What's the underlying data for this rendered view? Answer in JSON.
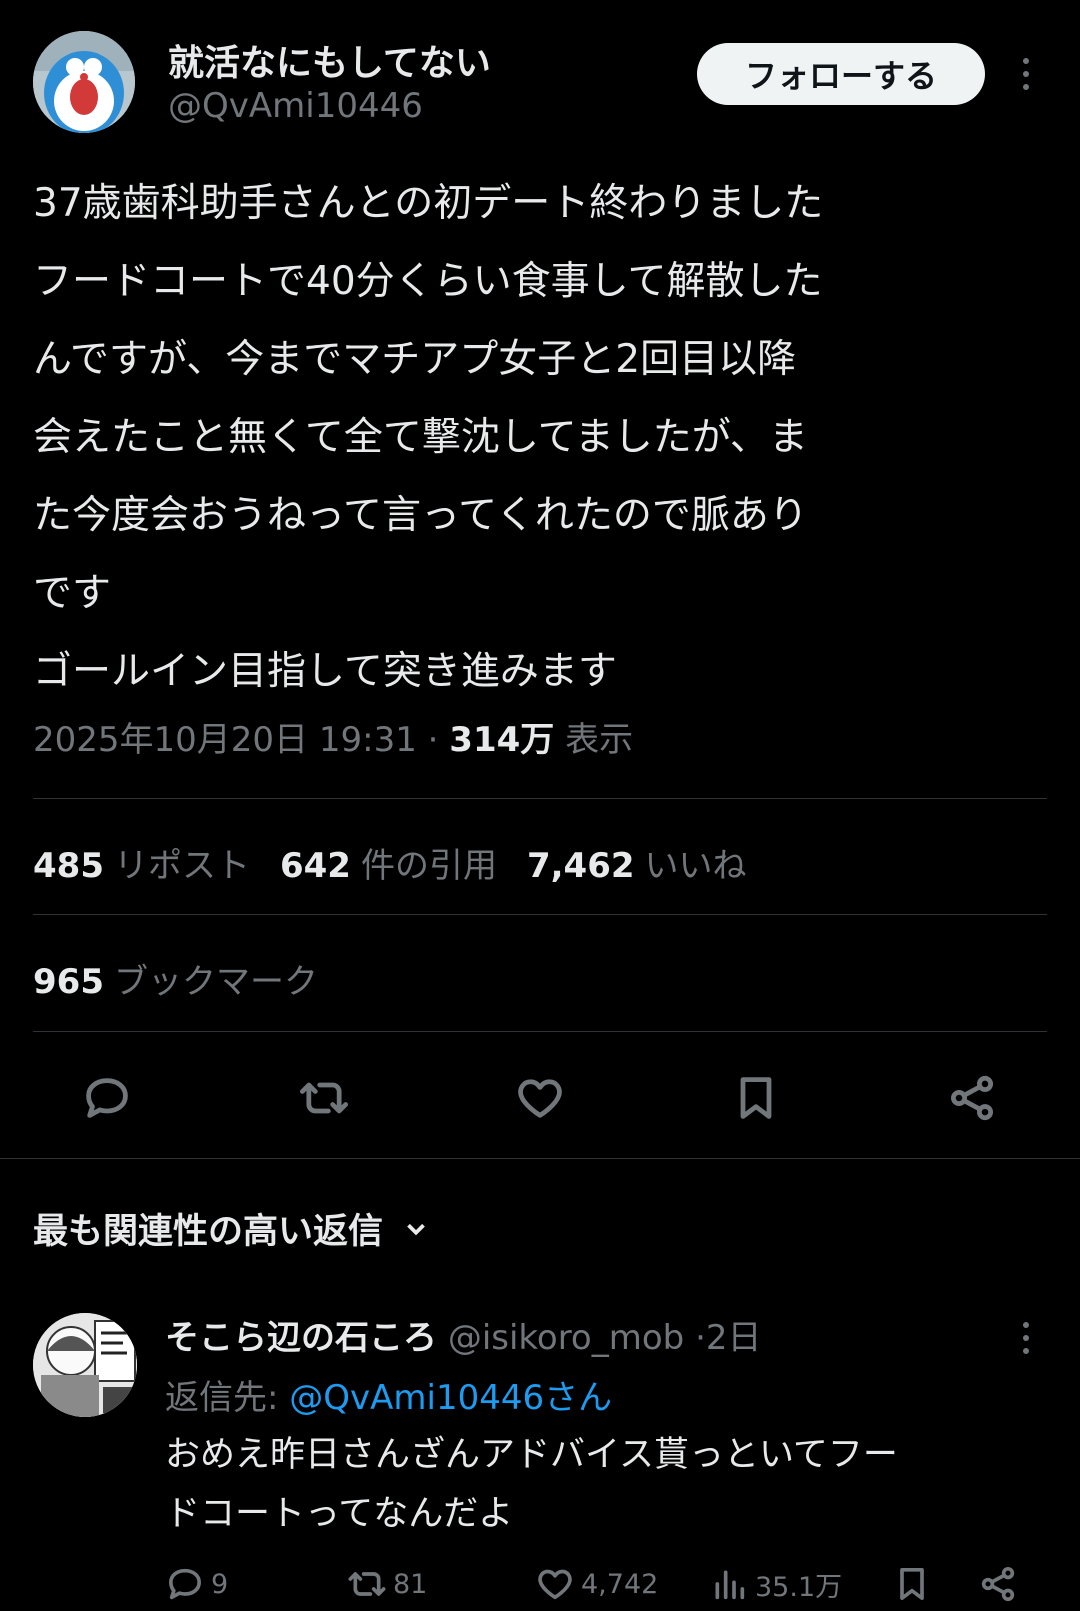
{
  "post": {
    "author_name": "就活なにもしてない",
    "author_handle": "@QvAmi10446",
    "follow_label": "フォローする",
    "lines": [
      "37歳歯科助手さんとの初デート終わりました",
      "フードコートで40分くらい食事して解散した",
      "んですが、今までマチアプ女子と2回目以降",
      "会えたこと無くて全て撃沈してましたが、ま",
      "た今度会おうねって言ってくれたので脈あり",
      "です",
      "ゴールイン目指して突き進みます"
    ],
    "datetime": "2025年10月20日 19:31",
    "separator": "·",
    "views_count": "314万",
    "views_label": "表示"
  },
  "stats": {
    "reposts_count": "485",
    "reposts_label": "リポスト",
    "quotes_count": "642",
    "quotes_label": "件の引用",
    "likes_count": "7,462",
    "likes_label": "いいね",
    "bookmarks_count": "965",
    "bookmarks_label": "ブックマーク"
  },
  "icons": {
    "actions": [
      "reply-icon",
      "repost-icon",
      "like-icon",
      "bookmark-icon",
      "share-icon"
    ],
    "more": "more-icon",
    "sort": "chevron-down-icon"
  },
  "replies_section": {
    "sort_label": "最も関連性の高い返信"
  },
  "reply": {
    "author_name": "そこら辺の石ころ",
    "author_handle": "@isikoro_mob",
    "separator": "·",
    "time": "2日",
    "reply_to_label": "返信先:",
    "reply_to_handle": "@QvAmi10446さん",
    "lines": [
      "おめえ昨日さんざんアドバイス貰っといてフー",
      "ドコートってなんだよ"
    ],
    "reply_count": "9",
    "repost_count": "81",
    "like_count": "4,742",
    "view_count": "35.1万"
  },
  "colors": {
    "background": "#000000",
    "text": "#e7e9ea",
    "muted": "#71767b",
    "link": "#1d9bf0",
    "divider": "#2f3336"
  }
}
